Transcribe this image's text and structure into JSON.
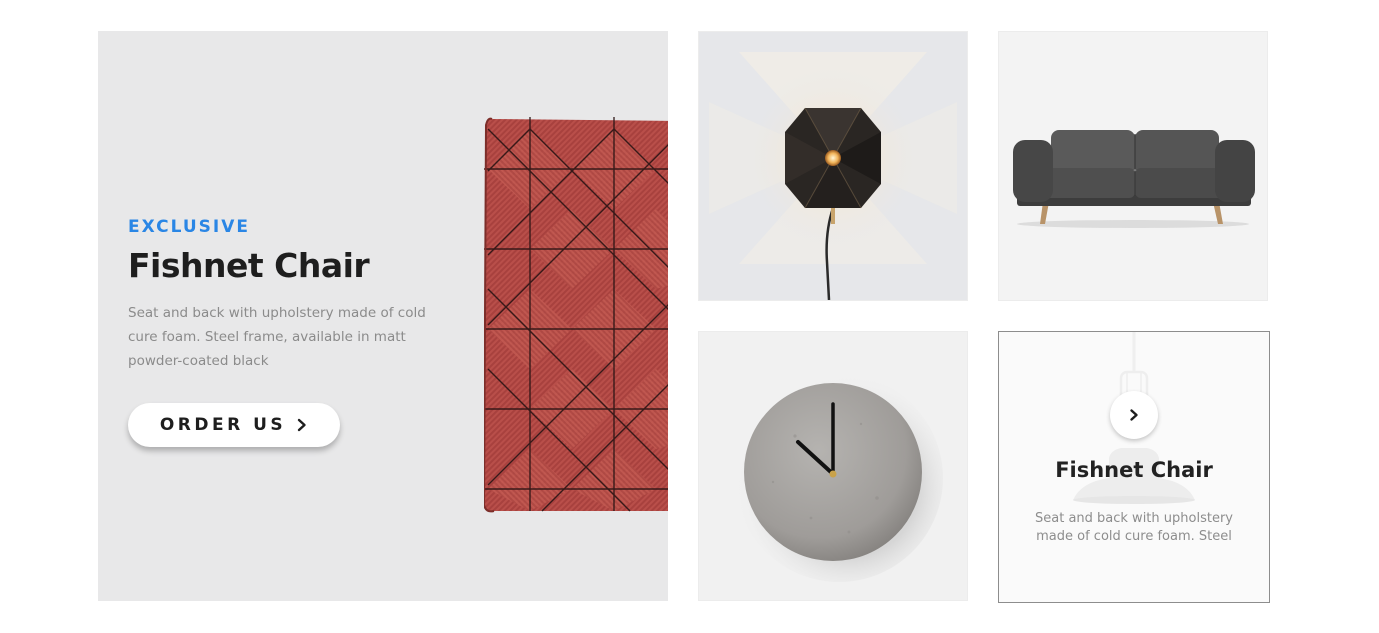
{
  "hero": {
    "eyebrow": "EXCLUSIVE",
    "title": "Fishnet Chair",
    "description": "Seat and back with upholstery made of cold cure foam. Steel frame, available in matt powder-coated black",
    "button_label": "ORDER US",
    "button_icon": "chevron-right-icon",
    "accent_color": "#2a86e5",
    "background_color": "#e8e8e9"
  },
  "tiles": [
    {
      "subject": "wall-lamp",
      "background_color": "#e6e7ea"
    },
    {
      "subject": "sofa",
      "background_color": "#f3f3f3"
    },
    {
      "subject": "wall-clock",
      "background_color": "#f1f1f1"
    }
  ],
  "hover_card": {
    "title": "Fishnet Chair",
    "description": "Seat and back with upholstery made of cold cure foam. Steel frame, available in matt powder-coated black",
    "button_icon": "chevron-right-icon",
    "border_color": "#8d8d8d"
  }
}
